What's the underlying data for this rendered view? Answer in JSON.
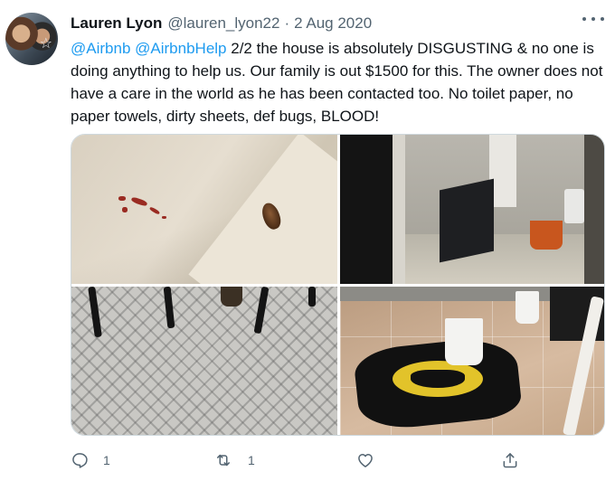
{
  "tweet": {
    "author_name": "Lauren Lyon",
    "handle": "@lauren_lyon22",
    "separator": "·",
    "date": "2 Aug 2020",
    "mention_1": "@Airbnb",
    "mention_2": "@AirbnbHelp",
    "body": " 2/2 the house is absolutely DISGUSTING & no one is doing anything to help us. Our family is out $1500 for this. The owner does not have a care in the world as he has been contacted too. No toilet paper, no paper towels, dirty sheets, def bugs, BLOOD!"
  },
  "actions": {
    "reply_count": "1",
    "retweet_count": "1"
  },
  "colors": {
    "accent": "#1d9bf0",
    "secondary_text": "#536471"
  },
  "icons": {
    "more": "more-horizontal-icon",
    "reply": "reply-icon",
    "retweet": "retweet-icon",
    "like": "heart-icon",
    "share": "share-icon"
  }
}
